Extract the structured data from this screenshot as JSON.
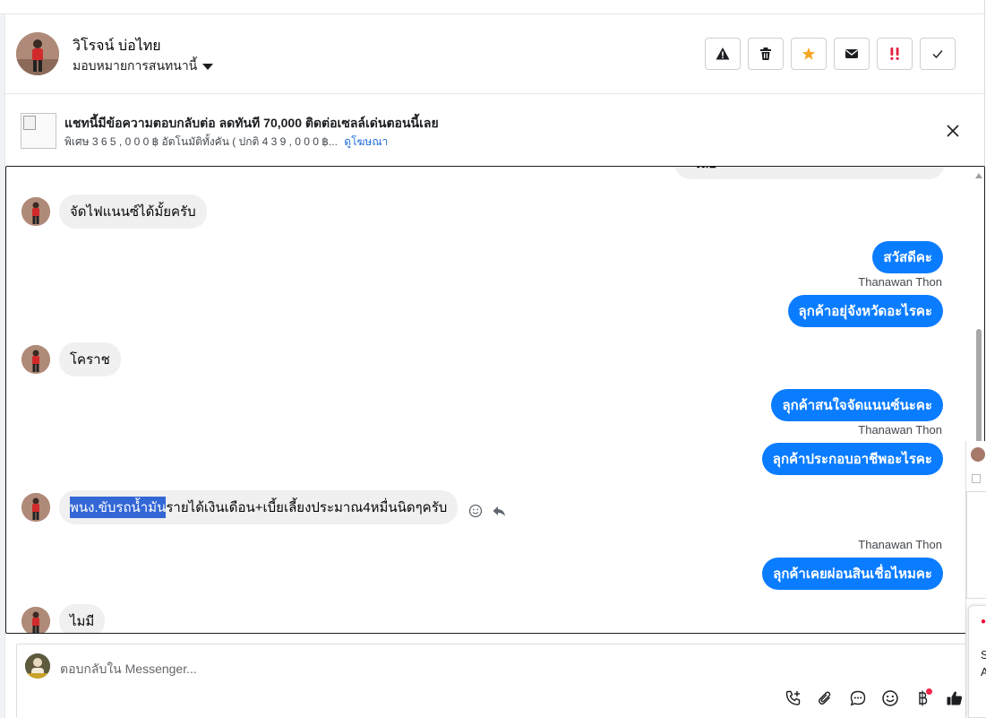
{
  "header": {
    "contact_name": "วิโรจน์ บ่อไทย",
    "assign_label": "มอบหมายการสนทนานี้",
    "actions": [
      {
        "name": "spam-icon",
        "color": "#1c1e21"
      },
      {
        "name": "trash-icon",
        "color": "#1c1e21"
      },
      {
        "name": "star-icon",
        "color": "#f5a623"
      },
      {
        "name": "mail-icon",
        "color": "#1c1e21"
      },
      {
        "name": "urgent-icon",
        "color": "#e41e3f"
      },
      {
        "name": "check-icon",
        "color": "#1c1e21"
      }
    ]
  },
  "ad": {
    "title": "แชทนี้มีข้อความตอบกลับต่อ ลดทันที 70,000 ติดต่อเซลล์เด่นตอนนี้เลย",
    "subtitle": "พิเศษ 🅢🅓🅔,🅞🅞🅞 ฿ อัตโนมัติทั้งคัน (ปกติ 🅔🅒🅘,🅞🅞🅞 ฿...",
    "subtitle_display": "พิเศษ 3 6 5 , 0 0 0 ฿ อัตโนมัติทั้งคัน ( ปกติ 4 3 9 , 0 0 0 ฿...",
    "link_label": "ดูโฆษณา"
  },
  "messages": {
    "top_clipped": "เลย",
    "m1": "จัดไฟแนนซ์ได้มั้ยครับ",
    "m2": "สวัสดีคะ",
    "sender1": "Thanawan Thon",
    "m3": "ลุกค้าอยุ่จังหวัดอะไรคะ",
    "m4": "โคราช",
    "m5": "ลุกค้าสนใจจัดแนนซ์นะคะ",
    "sender2": "Thanawan Thon",
    "m6": "ลุกค้าประกอบอาชีพอะไรคะ",
    "m7_highlight": "พนง.ขับรถน้ำมัน",
    "m7_rest": "รายได้เงินเดือน+เบี้ยเลี้ยงประมาณ4หมื่นนิดๆครับ",
    "sender3": "Thanawan Thon",
    "m8": "ลุกค้าเคยผ่อนสินเชื่อไหมคะ",
    "m9": "ไมมี"
  },
  "composer": {
    "placeholder": "ตอบกลับใน Messenger...",
    "tools": [
      "phone-add-icon",
      "attach-icon",
      "saved-reply-icon",
      "emoji-icon",
      "baht-icon",
      "like-icon"
    ]
  },
  "side_panel": {
    "letter1": "S",
    "letter2": "A"
  },
  "colors": {
    "outgoing_bubble": "#0a7cff",
    "incoming_bubble": "#f0f0f0",
    "highlight": "#3367d6",
    "link": "#216fdb"
  }
}
